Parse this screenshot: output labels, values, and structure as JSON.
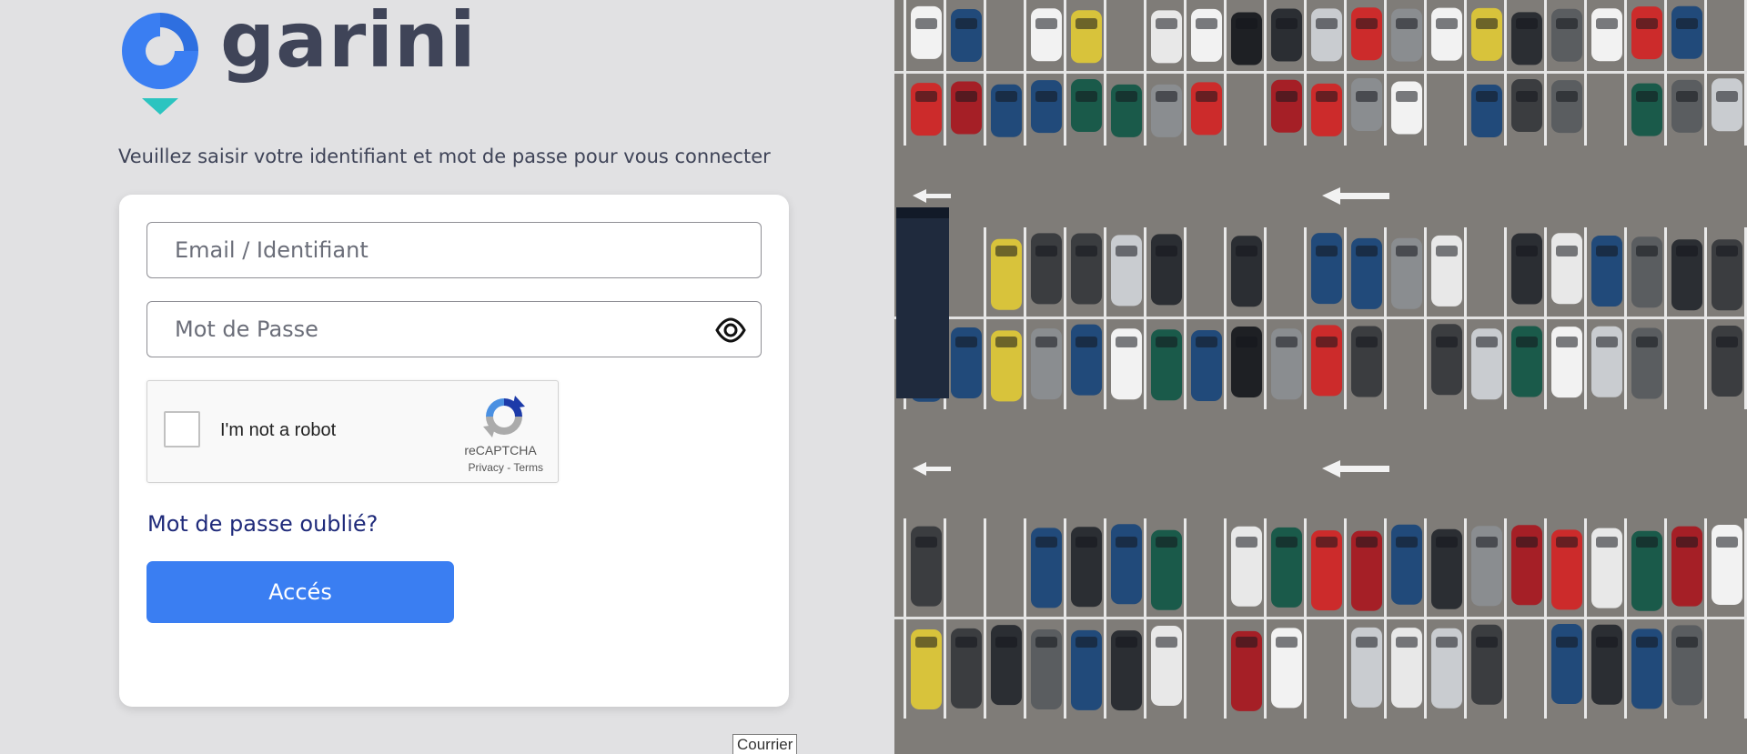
{
  "brand": {
    "name": "garini",
    "colors": {
      "primary": "#3a7ef2",
      "accent": "#2bc4c0",
      "text": "#3f4458",
      "link": "#1f2a7a"
    }
  },
  "login": {
    "instructions": "Veuillez saisir votre identifiant et mot de passe pour vous connecter",
    "email_placeholder": "Email / Identifiant",
    "password_placeholder": "Mot de Passe",
    "show_password_icon": "eye-icon",
    "forgot_password": "Mot de passe oublié?",
    "submit": "Accés"
  },
  "captcha": {
    "label": "I'm not a robot",
    "brand": "reCAPTCHA",
    "privacy": "Privacy",
    "separator": " - ",
    "terms": "Terms",
    "checked": false
  },
  "tooltip": {
    "text": "Courrier"
  },
  "hero_image": {
    "icon": "aerial-parking-lot-photo"
  }
}
